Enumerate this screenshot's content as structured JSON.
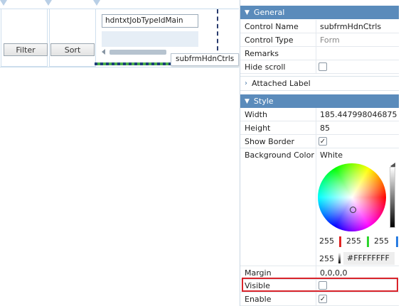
{
  "canvas": {
    "filter_label": "Filter",
    "sort_label": "Sort",
    "textbox_value": "hdntxtJobTypeIdMain",
    "subform_name": "subfrmHdnCtrls"
  },
  "properties": {
    "general": {
      "title": "General",
      "rows": [
        {
          "label": "Control Name",
          "value": "subfrmHdnCtrls"
        },
        {
          "label": "Control Type",
          "value": "Form"
        },
        {
          "label": "Remarks",
          "value": ""
        },
        {
          "label": "Hide scroll",
          "checked": false
        }
      ]
    },
    "attached_label": {
      "title": "Attached Label"
    },
    "style": {
      "title": "Style",
      "width_label": "Width",
      "width_value": "185.447998046875",
      "height_label": "Height",
      "height_value": "85",
      "show_border_label": "Show Border",
      "show_border_checked": true,
      "bg_label": "Background Color",
      "bg_value": "White",
      "picker": {
        "r": "255",
        "g": "255",
        "b": "255",
        "a": "255",
        "hex": "#FFFFFFFF"
      },
      "margin_label": "Margin",
      "margin_value": "0,0,0,0",
      "visible_label": "Visible",
      "visible_checked": false,
      "enable_label": "Enable",
      "enable_checked": true
    }
  },
  "icons": {
    "check": "✓",
    "chevron_down": "▼",
    "chevron_right": "›"
  },
  "colors": {
    "section_header": "#5a8bbb",
    "highlight": "#d9232a"
  }
}
